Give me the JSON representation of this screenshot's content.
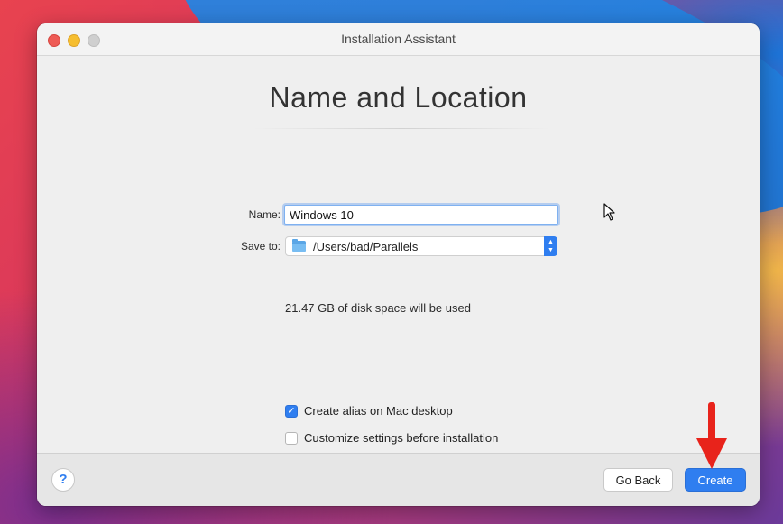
{
  "window": {
    "title": "Installation Assistant"
  },
  "page": {
    "heading": "Name and Location"
  },
  "form": {
    "name_label": "Name:",
    "name_value": "Windows 10",
    "save_label": "Save to:",
    "save_path": "/Users/bad/Parallels",
    "disk_info": "21.47 GB of disk space will be used"
  },
  "options": [
    {
      "label": "Create alias on Mac desktop",
      "checked": true
    },
    {
      "label": "Customize settings before installation",
      "checked": false
    }
  ],
  "footer": {
    "help_label": "?",
    "back_label": "Go Back",
    "create_label": "Create"
  },
  "icons": {
    "traffic_lights": [
      "close-icon",
      "minimize-icon",
      "zoom-icon"
    ],
    "folder": "folder-icon",
    "stepper": "chevron-up-down-icon",
    "cursor": "pointer-cursor-icon",
    "annotation": "red-arrow-icon"
  },
  "colors": {
    "accent": "#2f7ef0",
    "annotation": "#e8231b"
  }
}
